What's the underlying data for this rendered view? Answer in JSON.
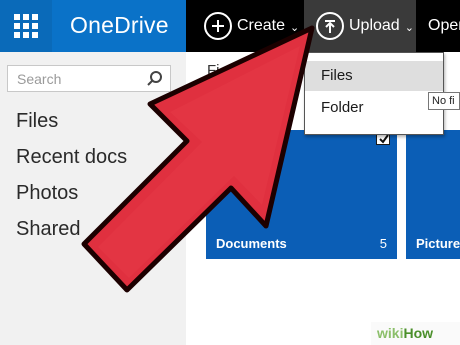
{
  "app": {
    "name": "OneDrive",
    "brand_color": "#0a72c8",
    "topbar_color": "#000000"
  },
  "commands": {
    "create_label": "Create",
    "create_icon": "plus-circle-icon",
    "upload_label": "Upload",
    "upload_icon": "upload-circle-icon",
    "open_label": "Open"
  },
  "sidebar": {
    "search_placeholder": "Search",
    "items": [
      {
        "label": "Files",
        "selected": true
      },
      {
        "label": "Recent docs"
      },
      {
        "label": "Photos"
      },
      {
        "label": "Shared"
      }
    ]
  },
  "main": {
    "header_partial": "Fi",
    "tiles": [
      {
        "name": "Documents",
        "count": "5",
        "checked": true
      },
      {
        "name": "Picture"
      }
    ],
    "tile_color": "#0b5eb6"
  },
  "upload_menu": {
    "items": [
      "Files",
      "Folder"
    ],
    "highlighted": "Files"
  },
  "tooltip": "No fi",
  "annotation": {
    "arrow_color": "#e0303f"
  },
  "watermark": {
    "part1": "wiki",
    "part2": "How"
  }
}
